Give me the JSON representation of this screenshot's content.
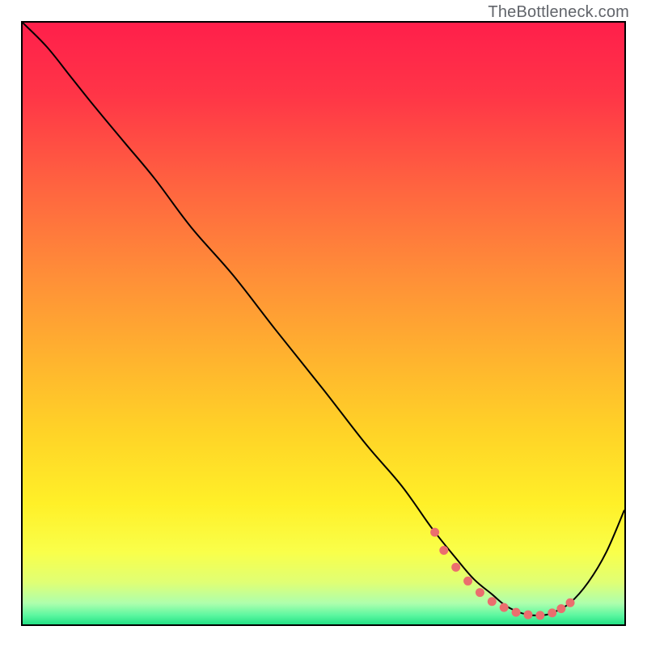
{
  "attribution": "TheBottleneck.com",
  "chart_data": {
    "type": "line",
    "title": "",
    "xlabel": "",
    "ylabel": "",
    "xlim": [
      0,
      100
    ],
    "ylim": [
      0,
      100
    ],
    "background_gradient": {
      "stops": [
        {
          "offset": 0.0,
          "color": "#ff1f4b"
        },
        {
          "offset": 0.12,
          "color": "#ff3547"
        },
        {
          "offset": 0.27,
          "color": "#ff6340"
        },
        {
          "offset": 0.42,
          "color": "#ff8e38"
        },
        {
          "offset": 0.55,
          "color": "#ffb12f"
        },
        {
          "offset": 0.68,
          "color": "#ffd327"
        },
        {
          "offset": 0.8,
          "color": "#fff028"
        },
        {
          "offset": 0.88,
          "color": "#f9ff4a"
        },
        {
          "offset": 0.93,
          "color": "#e0ff74"
        },
        {
          "offset": 0.965,
          "color": "#aeffad"
        },
        {
          "offset": 0.985,
          "color": "#5cf7a0"
        },
        {
          "offset": 1.0,
          "color": "#23e084"
        }
      ]
    },
    "series": [
      {
        "name": "bottleneck-curve",
        "color": "#000000",
        "stroke_width": 2,
        "x": [
          0,
          4,
          8,
          12,
          17,
          22,
          28,
          35,
          42,
          50,
          57,
          63,
          68,
          72,
          75,
          78,
          80,
          82,
          84,
          86,
          88,
          91,
          94,
          97,
          100
        ],
        "y": [
          100,
          96,
          91,
          86,
          80,
          74,
          66,
          58,
          49,
          39,
          30,
          23,
          16,
          11,
          7.5,
          5,
          3.3,
          2.2,
          1.6,
          1.5,
          1.9,
          3.6,
          7.0,
          12.0,
          19.0
        ]
      }
    ],
    "markers": {
      "name": "valley-highlight",
      "color": "#eb6e6e",
      "radius": 5.5,
      "points": [
        {
          "x": 68.5,
          "y": 15.3
        },
        {
          "x": 70.0,
          "y": 12.3
        },
        {
          "x": 72.0,
          "y": 9.5
        },
        {
          "x": 74.0,
          "y": 7.2
        },
        {
          "x": 76.0,
          "y": 5.3
        },
        {
          "x": 78.0,
          "y": 3.8
        },
        {
          "x": 80.0,
          "y": 2.8
        },
        {
          "x": 82.0,
          "y": 2.0
        },
        {
          "x": 84.0,
          "y": 1.6
        },
        {
          "x": 86.0,
          "y": 1.5
        },
        {
          "x": 88.0,
          "y": 1.9
        },
        {
          "x": 89.5,
          "y": 2.6
        },
        {
          "x": 91.0,
          "y": 3.6
        }
      ]
    }
  }
}
